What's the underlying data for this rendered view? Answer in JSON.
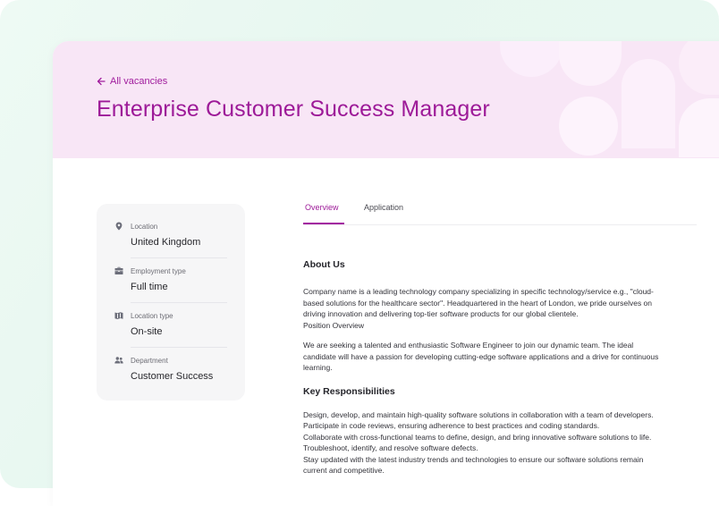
{
  "header": {
    "back_label": "All vacancies",
    "title": "Enterprise Customer Success Manager"
  },
  "sidebar": {
    "items": [
      {
        "icon": "location-pin-icon",
        "label": "Location",
        "value": "United Kingdom"
      },
      {
        "icon": "briefcase-icon",
        "label": "Employment type",
        "value": "Full time"
      },
      {
        "icon": "map-icon",
        "label": "Location type",
        "value": "On-site"
      },
      {
        "icon": "people-icon",
        "label": "Department",
        "value": "Customer Success"
      }
    ]
  },
  "tabs": [
    {
      "label": "Overview",
      "active": true
    },
    {
      "label": "Application",
      "active": false
    }
  ],
  "content": {
    "about_heading": "About Us",
    "about_lines": [
      "Company name is a leading technology company specializing in specific technology/service e.g., \"cloud-",
      "based solutions for the healthcare sector\". Headquartered in the heart of London, we pride ourselves on",
      "driving innovation and delivering top-tier software products for our global clientele.",
      "Position Overview"
    ],
    "intro_lines": [
      "We are seeking a talented and enthusiastic Software Engineer to join our dynamic team. The ideal",
      "candidate will have a passion for developing cutting-edge software applications and a drive for continuous",
      "learning."
    ],
    "resp_heading": "Key Responsibilities",
    "resp_lines": [
      "Design, develop, and maintain high-quality software solutions in collaboration with a team of developers.",
      "Participate in code reviews, ensuring adherence to best practices and coding standards.",
      "Collaborate with cross-functional teams to define, design, and bring innovative software solutions to life.",
      "Troubleshoot, identify, and resolve software defects.",
      "Stay updated with the latest industry trends and technologies to ensure our software solutions remain",
      "current and competitive."
    ]
  },
  "colors": {
    "accent": "#9d1a98",
    "hero_bg": "#f8e6f6",
    "page_bg": "#eaf9f2"
  }
}
